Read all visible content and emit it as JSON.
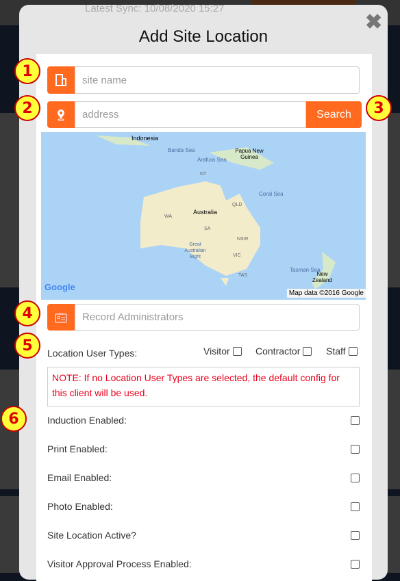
{
  "background": {
    "sync_text": "Latest Sync: 10/08/2020 15:27"
  },
  "modal": {
    "title": "Add Site Location",
    "close_icon": "close-icon"
  },
  "form": {
    "site_name_placeholder": "site name",
    "address_placeholder": "address",
    "search_label": "Search",
    "admins_placeholder": "Record Administrators",
    "user_types_label": "Location User Types:",
    "user_types": [
      "Visitor",
      "Contractor",
      "Staff"
    ],
    "note": "NOTE: If no Location User Types are selected, the default config for this client will be used.",
    "options": [
      "Induction Enabled:",
      "Print Enabled:",
      "Email Enabled:",
      "Photo Enabled:",
      "Site Location Active?",
      "Visitor Approval Process Enabled:"
    ]
  },
  "map": {
    "labels": [
      "Indonesia",
      "Banda Sea",
      "Arafura Sea",
      "Papua New Guinea",
      "Coral Sea",
      "NT",
      "QLD",
      "WA",
      "Australia",
      "SA",
      "NSW",
      "Great Australian Bight",
      "VIC",
      "Tasman Sea",
      "TAS",
      "New Zealand"
    ],
    "logo": "Google",
    "attribution": "Map data ©2016 Google"
  },
  "badges": [
    "1",
    "2",
    "3",
    "4",
    "5",
    "6"
  ],
  "colors": {
    "accent": "#ff6a1f",
    "note": "#e8001c",
    "badge_fill": "#ffff3a",
    "badge_text": "#e00000"
  }
}
